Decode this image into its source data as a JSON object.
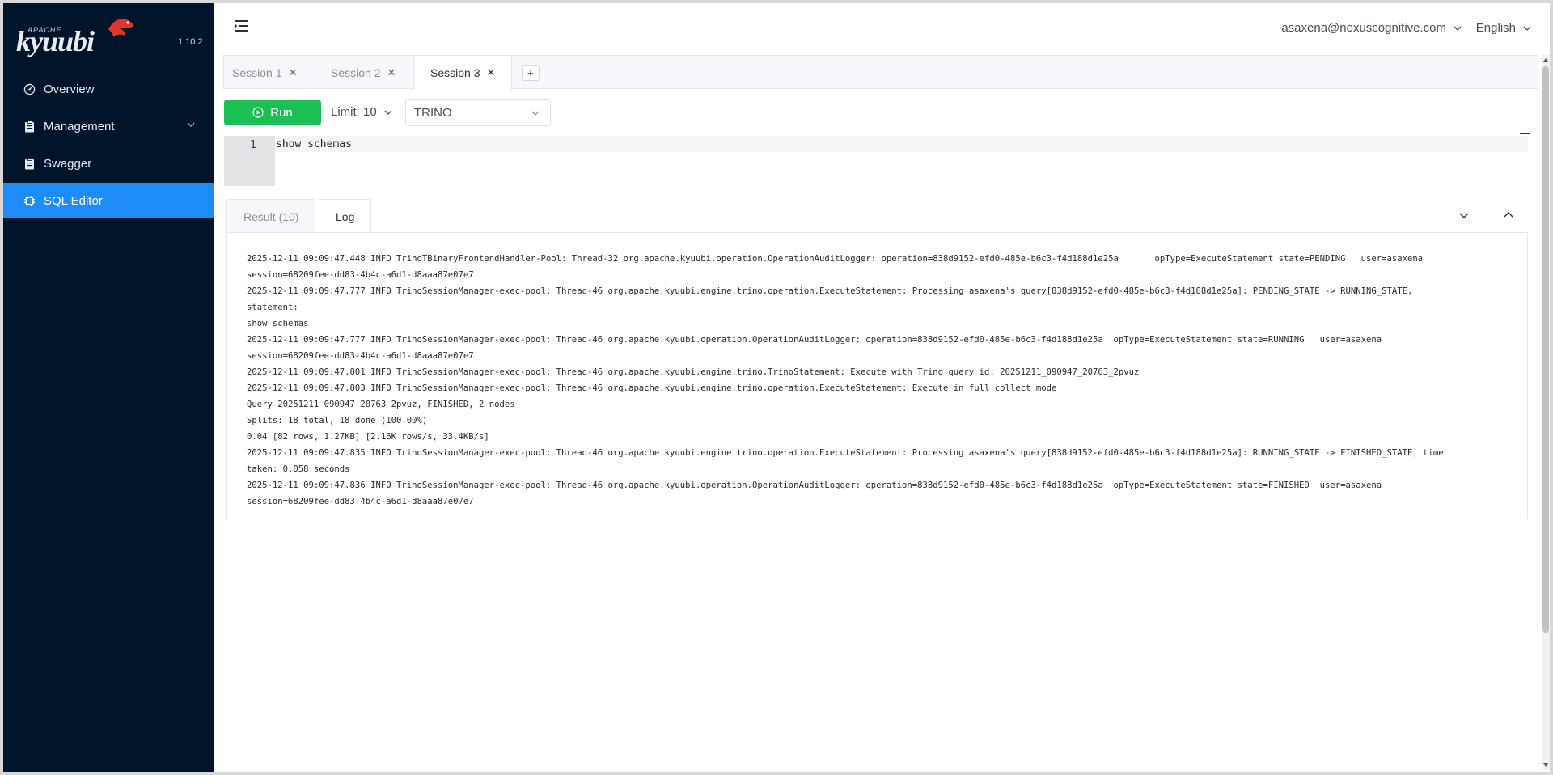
{
  "app": {
    "logo_top": "APACHE",
    "logo_word": "kyuubi",
    "version": "1.10.2"
  },
  "sidebar": {
    "items": [
      {
        "label": "Overview",
        "icon": "dashboard-icon"
      },
      {
        "label": "Management",
        "icon": "clipboard-icon"
      },
      {
        "label": "Swagger",
        "icon": "clipboard-icon"
      },
      {
        "label": "SQL Editor",
        "icon": "cpu-icon"
      }
    ],
    "active_index": 3
  },
  "header": {
    "user": "asaxena@nexuscognitive.com",
    "language": "English"
  },
  "session_tabs": [
    {
      "label": "Session 1"
    },
    {
      "label": "Session 2"
    },
    {
      "label": "Session 3"
    }
  ],
  "active_session": 2,
  "add_tab_label": "+",
  "toolbar": {
    "run_label": "Run",
    "limit_label": "Limit: 10",
    "engine_value": "TRINO"
  },
  "editor": {
    "line_number": "1",
    "code": "show schemas"
  },
  "result_tabs": [
    {
      "label": "Result (10)"
    },
    {
      "label": "Log"
    }
  ],
  "active_result_tab": 1,
  "log_lines": [
    "2025-12-11 09:09:47.448 INFO TrinoTBinaryFrontendHandler-Pool: Thread-32 org.apache.kyuubi.operation.OperationAuditLogger: operation=838d9152-efd0-485e-b6c3-f4d188d1e25a       opType=ExecuteStatement state=PENDING   user=asaxena",
    "session=68209fee-dd83-4b4c-a6d1-d8aaa87e07e7",
    "2025-12-11 09:09:47.777 INFO TrinoSessionManager-exec-pool: Thread-46 org.apache.kyuubi.engine.trino.operation.ExecuteStatement: Processing asaxena's query[838d9152-efd0-485e-b6c3-f4d188d1e25a]: PENDING_STATE -> RUNNING_STATE,",
    "statement:",
    "show schemas",
    "2025-12-11 09:09:47.777 INFO TrinoSessionManager-exec-pool: Thread-46 org.apache.kyuubi.operation.OperationAuditLogger: operation=838d9152-efd0-485e-b6c3-f4d188d1e25a  opType=ExecuteStatement state=RUNNING   user=asaxena",
    "session=68209fee-dd83-4b4c-a6d1-d8aaa87e07e7",
    "2025-12-11 09:09:47.801 INFO TrinoSessionManager-exec-pool: Thread-46 org.apache.kyuubi.engine.trino.TrinoStatement: Execute with Trino query id: 20251211_090947_20763_2pvuz",
    "2025-12-11 09:09:47.803 INFO TrinoSessionManager-exec-pool: Thread-46 org.apache.kyuubi.engine.trino.operation.ExecuteStatement: Execute in full collect mode",
    "Query 20251211_090947_20763_2pvuz, FINISHED, 2 nodes",
    "Splits: 18 total, 18 done (100.00%)",
    "0.04 [82 rows, 1.27KB] [2.16K rows/s, 33.4KB/s]",
    "2025-12-11 09:09:47.835 INFO TrinoSessionManager-exec-pool: Thread-46 org.apache.kyuubi.engine.trino.operation.ExecuteStatement: Processing asaxena's query[838d9152-efd0-485e-b6c3-f4d188d1e25a]: RUNNING_STATE -> FINISHED_STATE, time",
    "taken: 0.058 seconds",
    "2025-12-11 09:09:47.836 INFO TrinoSessionManager-exec-pool: Thread-46 org.apache.kyuubi.operation.OperationAuditLogger: operation=838d9152-efd0-485e-b6c3-f4d188d1e25a  opType=ExecuteStatement state=FINISHED  user=asaxena",
    "session=68209fee-dd83-4b4c-a6d1-d8aaa87e07e7"
  ],
  "colors": {
    "sidebar_bg": "#001529",
    "active_menu": "#1e8cf7",
    "run_button": "#1bbf53",
    "logo_bird": "#e0352b"
  }
}
